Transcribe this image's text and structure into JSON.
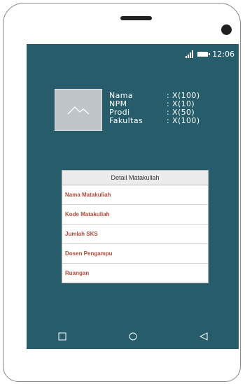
{
  "status_bar": {
    "time": "12:06",
    "signal_icon": "signal-icon",
    "battery_icon": "battery-icon"
  },
  "profile": {
    "avatar_icon": "image-placeholder-icon",
    "fields": [
      {
        "label": "Nama",
        "value": ": X(100)"
      },
      {
        "label": "NPM",
        "value": ": X(10)"
      },
      {
        "label": "Prodi",
        "value": ": X(50)"
      },
      {
        "label": "Fakultas",
        "value": ": X(100)"
      }
    ]
  },
  "detail_card": {
    "title": "Detail Matakuliah",
    "items": [
      "Nama Matakuliah",
      "Kode Matakuliah",
      "Jumlah SKS",
      "Dosen Pengampu",
      "Ruangan"
    ]
  },
  "nav_bar": {
    "recent_icon": "square-icon",
    "home_icon": "circle-icon",
    "back_icon": "triangle-back-icon"
  },
  "colors": {
    "screen_bg": "#275d6a",
    "item_text": "#b24a3a",
    "header_bg": "#ececec"
  }
}
